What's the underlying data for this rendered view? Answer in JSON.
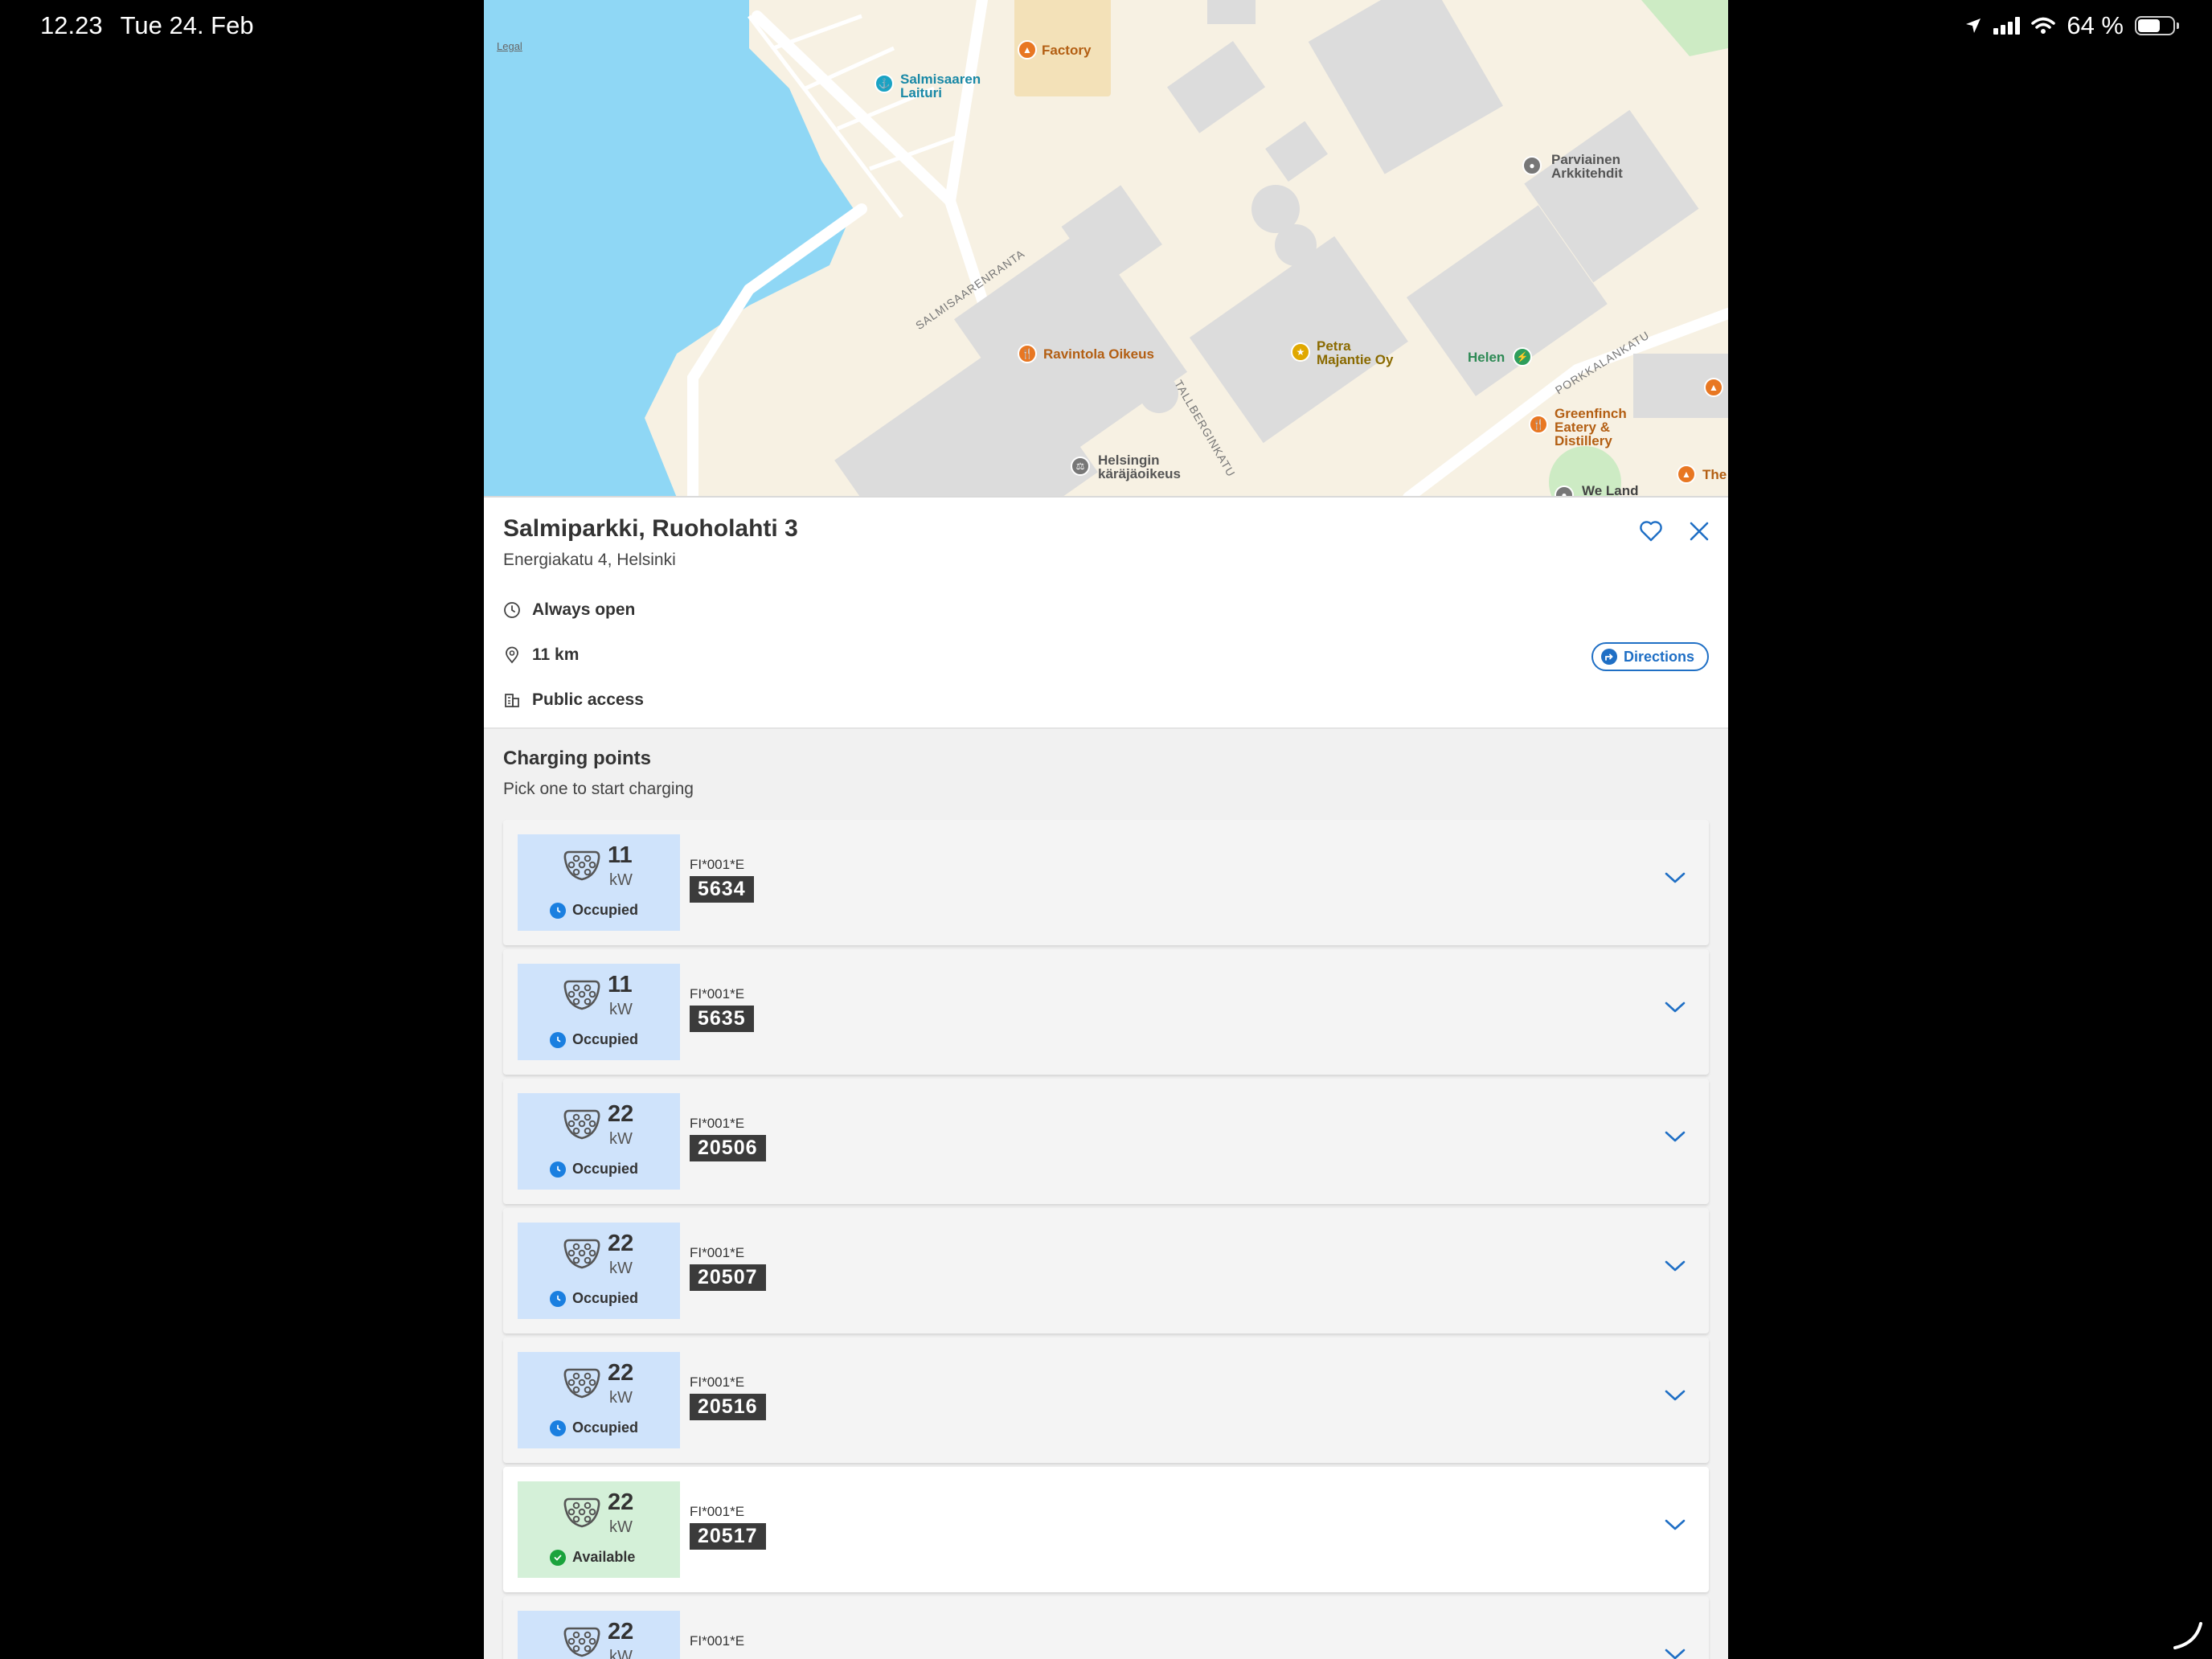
{
  "status_bar": {
    "time": "12.23",
    "date": "Tue 24. Feb",
    "battery": "64 %"
  },
  "map": {
    "legal": "Legal",
    "places": [
      {
        "name": "Factory",
        "color": "#e87722"
      },
      {
        "name": "Salmisaaren Laituri",
        "color": "#1aa3c4"
      },
      {
        "name": "Parviainen Arkkitehdit",
        "color": "#666666"
      },
      {
        "name": "Ravintola Oikeus",
        "color": "#e87722"
      },
      {
        "name": "Petra Majantie Oy",
        "color": "#d99a00"
      },
      {
        "name": "Helen",
        "color": "#2e9e5b"
      },
      {
        "name": "Greenfinch Eatery & Distillery",
        "color": "#e87722"
      },
      {
        "name": "Helsingin käräjäoikeus",
        "color": "#666666"
      },
      {
        "name": "We Land",
        "color": "#555555"
      },
      {
        "name": "The",
        "color": "#e87722"
      }
    ],
    "streets": [
      "SALMISAARENRANTA",
      "TALLBERGINKATU",
      "PORKKALANKATU"
    ]
  },
  "station": {
    "name": "Salmiparkki, Ruoholahti 3",
    "address": "Energiakatu 4, Helsinki",
    "hours": "Always open",
    "distance": "11 km",
    "access": "Public access",
    "directions_label": "Directions"
  },
  "charging": {
    "title": "Charging points",
    "subtitle": "Pick one to start charging",
    "points": [
      {
        "power": "11",
        "unit": "kW",
        "status": "Occupied",
        "prefix": "FI*001*E",
        "code": "5634"
      },
      {
        "power": "11",
        "unit": "kW",
        "status": "Occupied",
        "prefix": "FI*001*E",
        "code": "5635"
      },
      {
        "power": "22",
        "unit": "kW",
        "status": "Occupied",
        "prefix": "FI*001*E",
        "code": "20506"
      },
      {
        "power": "22",
        "unit": "kW",
        "status": "Occupied",
        "prefix": "FI*001*E",
        "code": "20507"
      },
      {
        "power": "22",
        "unit": "kW",
        "status": "Occupied",
        "prefix": "FI*001*E",
        "code": "20516"
      },
      {
        "power": "22",
        "unit": "kW",
        "status": "Available",
        "prefix": "FI*001*E",
        "code": "20517"
      },
      {
        "power": "22",
        "unit": "kW",
        "status": "",
        "prefix": "FI*001*E",
        "code": ""
      }
    ]
  },
  "colors": {
    "accent": "#1f6fc5",
    "occupied": "#1a7fe0",
    "available": "#1aa33c",
    "water": "#8fd7f5"
  }
}
